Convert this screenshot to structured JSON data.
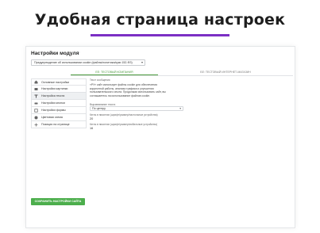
{
  "headline": "Удобная страница настроек",
  "panel": {
    "title": "Настройки модуля",
    "select_value": "Предупреждение об использовании cookie (файлы/политика/куки 152-ФЗ)"
  },
  "tabs": [
    {
      "label": "ЕЕ: ТЕСТОВЫЙ КОМПАНИЯ"
    },
    {
      "label": "БЕ: ТЕСТОВЫЙ ИНТЕРНЕТ-МАГАЗИН"
    }
  ],
  "sidebar": {
    "items": [
      {
        "label": "Основные настройки",
        "icon": "home-icon"
      },
      {
        "label": "Настройки картинки",
        "icon": "image-icon"
      },
      {
        "label": "Настройка текста",
        "icon": "text-icon"
      },
      {
        "label": "Настройки кнопки",
        "icon": "button-icon"
      },
      {
        "label": "Настройки формы",
        "icon": "form-icon"
      },
      {
        "label": "Цветовая схема",
        "icon": "palette-icon"
      },
      {
        "label": "Позиция на странице",
        "icon": "position-icon"
      }
    ]
  },
  "content": {
    "section_label": "Текст сообщения",
    "message": "«РУ» сайт использует файлы cookie для обеспечения корректной работы, анализа трафика и улучшения пользовательского опыта. Продолжая использовать сайт, вы соглашаетесь на использование файлов cookie.",
    "align_label": "Выравнивание текста",
    "align_value": "По центру",
    "desktop_label": "Кегль в пикселях (шрифт/размер/настольные устройства)",
    "desktop_value": "20",
    "mobile_label": "Кегль в пикселях (шрифт/размер/мобильные устройства)",
    "mobile_value": "16"
  },
  "save_button": "СОХРАНИТЬ НАСТРОЙКИ САЙТА"
}
